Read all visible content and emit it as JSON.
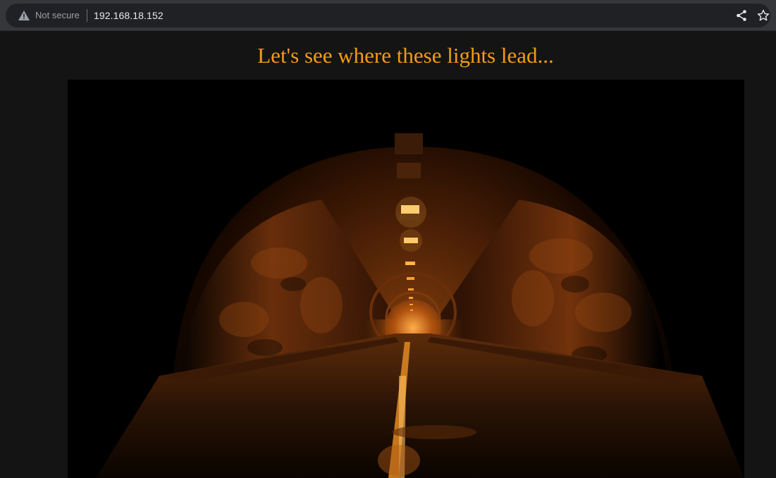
{
  "browser": {
    "security_label": "Not secure",
    "url": "192.168.18.152",
    "icons": {
      "security": "warning-triangle-icon",
      "share": "share-icon",
      "bookmark": "star-icon"
    }
  },
  "page": {
    "heading": "Let's see where these lights lead...",
    "heading_color": "#f39c12",
    "background_color": "#141414",
    "hero_image": {
      "subject": "tunnel-road-lights",
      "colors": [
        "#000000",
        "#e06a10",
        "#ffb347"
      ]
    }
  }
}
